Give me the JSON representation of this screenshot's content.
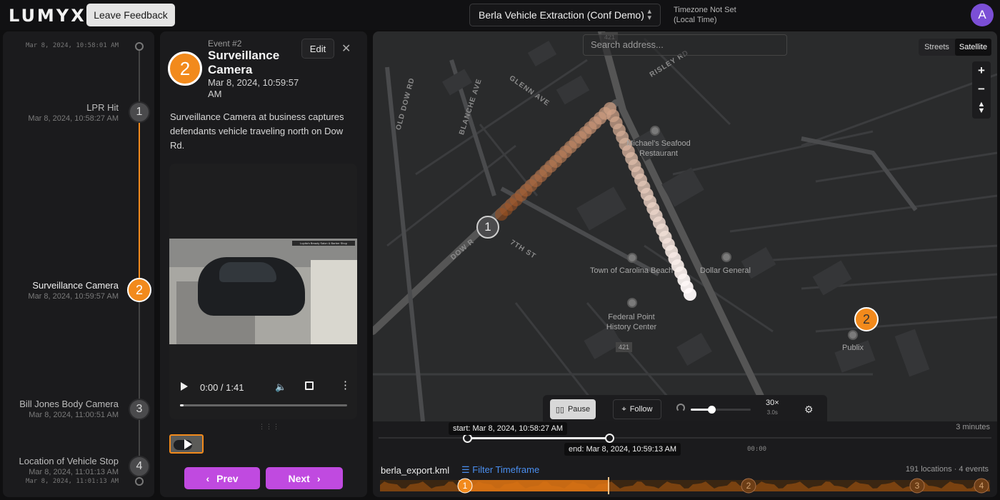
{
  "app": {
    "logo": "LUMYX",
    "feedback_label": "Leave Feedback",
    "project": "Berla Vehicle Extraction (Conf Demo)",
    "timezone_line1": "Timezone Not Set",
    "timezone_line2": "(Local Time)",
    "avatar_initial": "A"
  },
  "timeline": {
    "start_stamp": "Mar 8, 2024, 10:58:01 AM",
    "end_stamp": "Mar 8, 2024, 11:01:13 AM",
    "events": [
      {
        "num": "1",
        "name": "LPR Hit",
        "time": "Mar 8, 2024, 10:58:27 AM"
      },
      {
        "num": "2",
        "name": "Surveillance Camera",
        "time": "Mar 8, 2024, 10:59:57 AM"
      },
      {
        "num": "3",
        "name": "Bill Jones Body Camera",
        "time": "Mar 8, 2024, 11:00:51 AM"
      },
      {
        "num": "4",
        "name": "Location of Vehicle Stop",
        "time": "Mar 8, 2024, 11:01:13 AM"
      }
    ]
  },
  "detail": {
    "badge": "2",
    "event_num": "Event #2",
    "title": "Surveillance Camera",
    "time": "Mar 8, 2024, 10:59:57 AM",
    "edit_label": "Edit",
    "close_glyph": "✕",
    "description": "Surveillance Camera at business captures defendants vehicle traveling north on Dow Rd.",
    "video_caption": "Lupita's Beauty Salon & Barber Shop",
    "video_time": "0:00 / 1:41",
    "video_progress": 0.02,
    "prev_label": "Prev",
    "next_label": "Next"
  },
  "map": {
    "search_placeholder": "Search address...",
    "type_streets": "Streets",
    "type_satellite": "Satellite",
    "selected_type": "Satellite",
    "zoom_in": "+",
    "zoom_out": "−",
    "streets": [
      "GLENN AVE",
      "RISLEY RD",
      "OLD DOW RD",
      "BLANCHE AVE",
      "DOW R",
      "7TH ST"
    ],
    "route_badge": "421",
    "route_badge_2": "421",
    "places": {
      "seafood": "Michael's Seafood Restaurant",
      "town": "Town of Carolina Beach",
      "dollar": "Dollar General",
      "history": "Federal Point History Center",
      "publix": "Publix"
    },
    "marker1": "1",
    "marker2": "2"
  },
  "playback": {
    "pause_label": "Pause",
    "follow_label": "Follow",
    "speed": "30×",
    "speed_sub": "3.0s",
    "speed_level": 0.35
  },
  "scrubber": {
    "duration": "3 minutes",
    "start_tip": "start: Mar 8, 2024, 10:58:27 AM",
    "end_tip": "end: Mar 8, 2024, 10:59:13 AM",
    "clock": "00:00"
  },
  "track": {
    "file": "berla_export.kml",
    "filter_label": "Filter Timeframe",
    "count": "191 locations · 4 events",
    "event_markers": [
      "1",
      "2",
      "3",
      "4"
    ]
  },
  "colors": {
    "accent": "#f28a1c",
    "button_purple": "#c04ae0",
    "link_blue": "#4a8ff0"
  }
}
